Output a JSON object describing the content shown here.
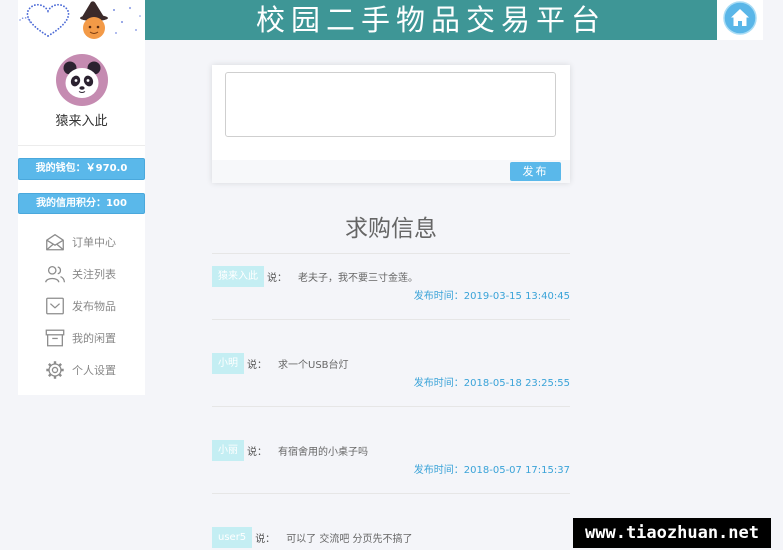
{
  "header": {
    "title": "校园二手物品交易平台",
    "logo_icon": "hearts-witch-logo-icon",
    "home_icon": "home-icon"
  },
  "sidebar": {
    "avatar_icon": "panda-avatar-icon",
    "username": "猿来入此",
    "wallet_label": "我的钱包：￥970.0",
    "credit_label": "我的信用积分：100",
    "menu": [
      {
        "label": "订单中心",
        "icon": "mail-icon"
      },
      {
        "label": "关注列表",
        "icon": "users-icon"
      },
      {
        "label": "发布物品",
        "icon": "tray-icon"
      },
      {
        "label": "我的闲置",
        "icon": "archive-icon"
      },
      {
        "label": "个人设置",
        "icon": "gear-icon"
      }
    ]
  },
  "composer": {
    "value": "",
    "submit_label": "发布"
  },
  "requests": {
    "title": "求购信息",
    "say_label": "说：",
    "posts": [
      {
        "author": "猿来入此",
        "text": "老夫子，我不要三寸金莲。",
        "time": "发布时间：2019-03-15 13:40:45"
      },
      {
        "author": "小明",
        "text": "求一个USB台灯",
        "time": "发布时间：2018-05-18 23:25:55"
      },
      {
        "author": "小丽",
        "text": "有宿舍用的小桌子吗",
        "time": "发布时间：2018-05-07 17:15:37"
      },
      {
        "author": "user5",
        "text": "可以了 交流吧 分页先不搞了"
      }
    ]
  },
  "watermark": {
    "text": "www.tiaozhuan.net"
  },
  "colors": {
    "header": "#3e9696",
    "accent": "#5ab8ea",
    "accent-border": "#4aa8dc",
    "tag": "#c4eef3",
    "time": "#3aa3d8",
    "page-bg": "#f4f5f9"
  }
}
